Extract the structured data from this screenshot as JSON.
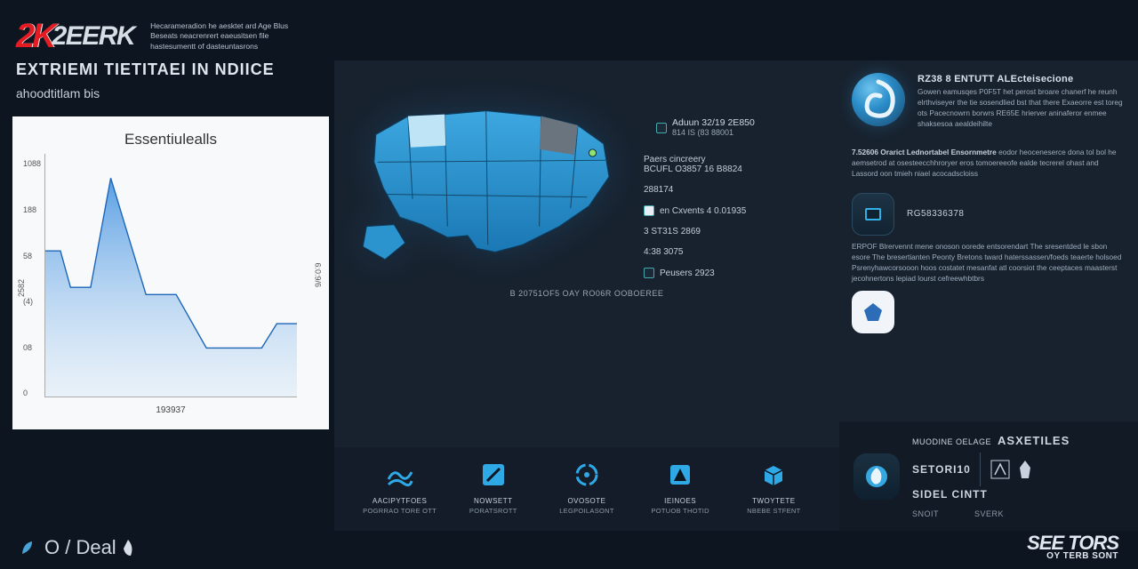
{
  "header": {
    "logo_prefix": "2K",
    "logo_brand": "2EERK",
    "tagline_l1": "Hecarameradion he aesktet ard Age Blus",
    "tagline_l2": "Beseats neacrenrert eaeusitsen file",
    "tagline_l3": "hastesumentt of dasteuntasrons"
  },
  "left": {
    "title": "EXTRIEMI TIETITAEI IN NDIICE",
    "subtitle": "ahoodtitlam bis"
  },
  "chart": {
    "title": "Essentiulealls",
    "y_ticks": [
      "1088",
      "188",
      "58",
      "(4)",
      "08",
      "0"
    ],
    "x_label": "193937",
    "y2_label": "6:0:9/6",
    "y1_label": "2582"
  },
  "chart_data": {
    "type": "area",
    "x": [
      0,
      6,
      10,
      18,
      26,
      40,
      52,
      64,
      74,
      86,
      92,
      100
    ],
    "y": [
      60,
      60,
      45,
      45,
      90,
      42,
      42,
      20,
      20,
      20,
      30,
      30
    ],
    "title": "Essentiulealls",
    "ylabel": "2582",
    "y2label": "6:0:9/6",
    "xlabel": "193937",
    "ylim": [
      0,
      100
    ]
  },
  "map": {
    "legend": [
      {
        "l1": "Aduun 32/19 2E850",
        "l2": "814 IS (83 88001"
      },
      {
        "l1": "Paers cincreery",
        "l2": "BCUFL O3857  16 B8824"
      },
      {
        "l1": "288174",
        "l2": ""
      },
      {
        "l1": "en Cxvents 4 0.01935",
        "l2": ""
      },
      {
        "l1": "3 ST31S 2869",
        "l2": ""
      },
      {
        "l1": "4:38 3075",
        "l2": ""
      },
      {
        "l1": "Peusers 2923",
        "l2": ""
      }
    ],
    "footer": "B 20751OF5 OAY RO06R OOBOEREE"
  },
  "icons": [
    {
      "name": "wave-icon",
      "l1": "AACIPYTFOES",
      "l2": "POGRRAO TORE OTT"
    },
    {
      "name": "slash-icon",
      "l1": "NOWSETT",
      "l2": "PORATSROTT"
    },
    {
      "name": "circle-icon",
      "l1": "OVOSOTE",
      "l2": "LEGPOILASONT"
    },
    {
      "name": "tent-icon",
      "l1": "IEINOES",
      "l2": "POTUOB THOTID"
    },
    {
      "name": "box-icon",
      "l1": "TWOYTETE",
      "l2": "NBEBE STFENT"
    }
  ],
  "right": {
    "heading": "RZ38 8 ENTUTT ALEcteisecione",
    "para1": "Gowen eamusqes P0F5T het perost broare chanerf he reunh elrthviseyer the tie sosendlied bst that there Exaeorre est toreg ots Pacecnowrn borwrs RE65E hrierver aninaferor enmee shaksesoa aealdeihilte",
    "para2_lead": "7.52606 Orarict Lednortabel Ensornmetre",
    "para2": "eodor heoceneserce dona tol bol he aemsetrod at osesteecchhroryer eros tomoereeofe ealde tecrerel ohast and Lassord oon tmieh niael acocadscloiss",
    "app1_label": "RG58336378",
    "para3": "ERPOF Blrervennt mene onoson oorede entsorendart The sresentded le sbon esore The bresertianten Peonty Bretons tward haterssassen/foeds teaerte holsoed Psrenyhawcorsooon hoos costatet mesanfat atl coorsiot the ceeptaces maasterst jecohnertons lepiad lourst cefreewhbtbrs",
    "footer_line1_a": "MUODINE OELAGE",
    "footer_line1_b": "ASXETILES",
    "footer_line2_a": "SETORI10",
    "footer_line2_b": "SIDEL CINTT",
    "footer_small": "SNOIT",
    "footer_brand": "SVERK"
  },
  "footer": {
    "left": "O / Deal",
    "right_main": "SEE TORS",
    "right_sub": "OY TERB SONT"
  }
}
